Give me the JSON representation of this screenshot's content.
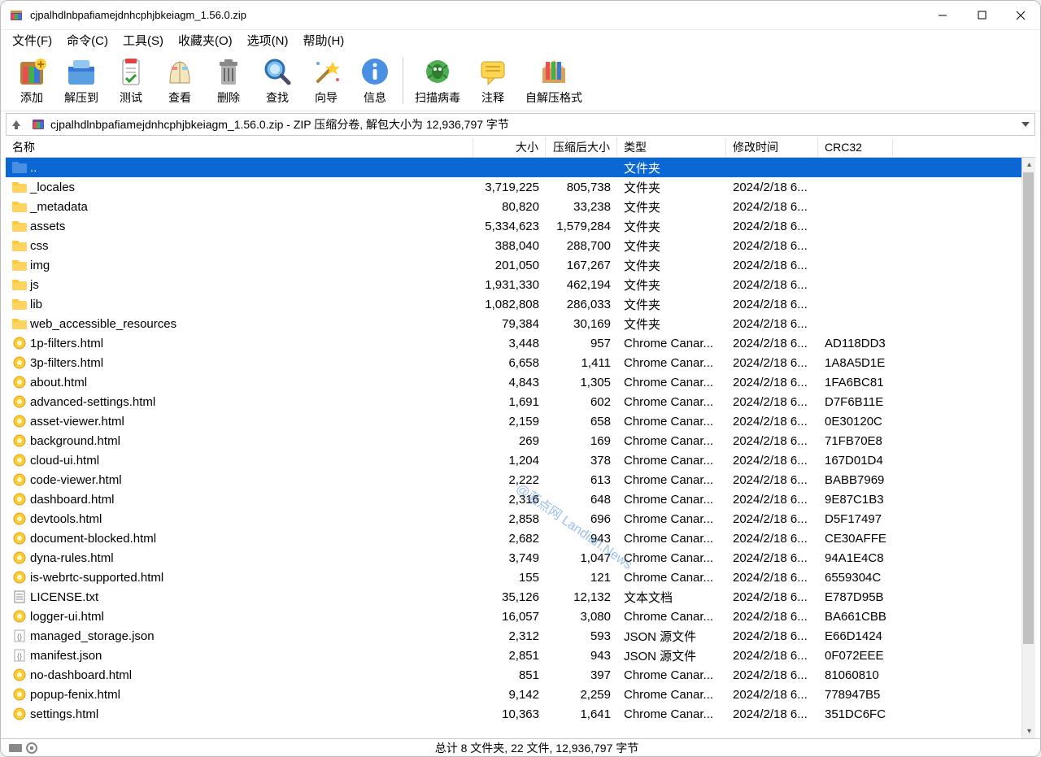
{
  "window": {
    "title": "cjpalhdlnbpafiamejdnhcphjbkeiagm_1.56.0.zip"
  },
  "menu": {
    "file": "文件(F)",
    "command": "命令(C)",
    "tools": "工具(S)",
    "favorites": "收藏夹(O)",
    "options": "选项(N)",
    "help": "帮助(H)"
  },
  "toolbar": {
    "add": "添加",
    "extract_to": "解压到",
    "test": "测试",
    "view": "查看",
    "delete": "删除",
    "find": "查找",
    "wizard": "向导",
    "info": "信息",
    "scan": "扫描病毒",
    "comment": "注释",
    "sfx": "自解压格式"
  },
  "pathbar": {
    "text": "cjpalhdlnbpafiamejdnhcphjbkeiagm_1.56.0.zip - ZIP 压缩分卷, 解包大小为 12,936,797 字节"
  },
  "columns": {
    "name": "名称",
    "size": "大小",
    "packed": "压缩后大小",
    "type": "类型",
    "modified": "修改时间",
    "crc": "CRC32"
  },
  "rows": [
    {
      "name": "..",
      "size": "",
      "packed": "",
      "type": "文件夹",
      "date": "",
      "crc": "",
      "icon": "up",
      "selected": true
    },
    {
      "name": "_locales",
      "size": "3,719,225",
      "packed": "805,738",
      "type": "文件夹",
      "date": "2024/2/18 6...",
      "crc": "",
      "icon": "folder"
    },
    {
      "name": "_metadata",
      "size": "80,820",
      "packed": "33,238",
      "type": "文件夹",
      "date": "2024/2/18 6...",
      "crc": "",
      "icon": "folder"
    },
    {
      "name": "assets",
      "size": "5,334,623",
      "packed": "1,579,284",
      "type": "文件夹",
      "date": "2024/2/18 6...",
      "crc": "",
      "icon": "folder"
    },
    {
      "name": "css",
      "size": "388,040",
      "packed": "288,700",
      "type": "文件夹",
      "date": "2024/2/18 6...",
      "crc": "",
      "icon": "folder"
    },
    {
      "name": "img",
      "size": "201,050",
      "packed": "167,267",
      "type": "文件夹",
      "date": "2024/2/18 6...",
      "crc": "",
      "icon": "folder"
    },
    {
      "name": "js",
      "size": "1,931,330",
      "packed": "462,194",
      "type": "文件夹",
      "date": "2024/2/18 6...",
      "crc": "",
      "icon": "folder"
    },
    {
      "name": "lib",
      "size": "1,082,808",
      "packed": "286,033",
      "type": "文件夹",
      "date": "2024/2/18 6...",
      "crc": "",
      "icon": "folder"
    },
    {
      "name": "web_accessible_resources",
      "size": "79,384",
      "packed": "30,169",
      "type": "文件夹",
      "date": "2024/2/18 6...",
      "crc": "",
      "icon": "folder"
    },
    {
      "name": "1p-filters.html",
      "size": "3,448",
      "packed": "957",
      "type": "Chrome Canar...",
      "date": "2024/2/18 6...",
      "crc": "AD118DD3",
      "icon": "html"
    },
    {
      "name": "3p-filters.html",
      "size": "6,658",
      "packed": "1,411",
      "type": "Chrome Canar...",
      "date": "2024/2/18 6...",
      "crc": "1A8A5D1E",
      "icon": "html"
    },
    {
      "name": "about.html",
      "size": "4,843",
      "packed": "1,305",
      "type": "Chrome Canar...",
      "date": "2024/2/18 6...",
      "crc": "1FA6BC81",
      "icon": "html"
    },
    {
      "name": "advanced-settings.html",
      "size": "1,691",
      "packed": "602",
      "type": "Chrome Canar...",
      "date": "2024/2/18 6...",
      "crc": "D7F6B11E",
      "icon": "html"
    },
    {
      "name": "asset-viewer.html",
      "size": "2,159",
      "packed": "658",
      "type": "Chrome Canar...",
      "date": "2024/2/18 6...",
      "crc": "0E30120C",
      "icon": "html"
    },
    {
      "name": "background.html",
      "size": "269",
      "packed": "169",
      "type": "Chrome Canar...",
      "date": "2024/2/18 6...",
      "crc": "71FB70E8",
      "icon": "html"
    },
    {
      "name": "cloud-ui.html",
      "size": "1,204",
      "packed": "378",
      "type": "Chrome Canar...",
      "date": "2024/2/18 6...",
      "crc": "167D01D4",
      "icon": "html"
    },
    {
      "name": "code-viewer.html",
      "size": "2,222",
      "packed": "613",
      "type": "Chrome Canar...",
      "date": "2024/2/18 6...",
      "crc": "BABB7969",
      "icon": "html"
    },
    {
      "name": "dashboard.html",
      "size": "2,316",
      "packed": "648",
      "type": "Chrome Canar...",
      "date": "2024/2/18 6...",
      "crc": "9E87C1B3",
      "icon": "html"
    },
    {
      "name": "devtools.html",
      "size": "2,858",
      "packed": "696",
      "type": "Chrome Canar...",
      "date": "2024/2/18 6...",
      "crc": "D5F17497",
      "icon": "html"
    },
    {
      "name": "document-blocked.html",
      "size": "2,682",
      "packed": "943",
      "type": "Chrome Canar...",
      "date": "2024/2/18 6...",
      "crc": "CE30AFFE",
      "icon": "html"
    },
    {
      "name": "dyna-rules.html",
      "size": "3,749",
      "packed": "1,047",
      "type": "Chrome Canar...",
      "date": "2024/2/18 6...",
      "crc": "94A1E4C8",
      "icon": "html"
    },
    {
      "name": "is-webrtc-supported.html",
      "size": "155",
      "packed": "121",
      "type": "Chrome Canar...",
      "date": "2024/2/18 6...",
      "crc": "6559304C",
      "icon": "html"
    },
    {
      "name": "LICENSE.txt",
      "size": "35,126",
      "packed": "12,132",
      "type": "文本文档",
      "date": "2024/2/18 6...",
      "crc": "E787D95B",
      "icon": "txt"
    },
    {
      "name": "logger-ui.html",
      "size": "16,057",
      "packed": "3,080",
      "type": "Chrome Canar...",
      "date": "2024/2/18 6...",
      "crc": "BA661CBB",
      "icon": "html"
    },
    {
      "name": "managed_storage.json",
      "size": "2,312",
      "packed": "593",
      "type": "JSON 源文件",
      "date": "2024/2/18 6...",
      "crc": "E66D1424",
      "icon": "json"
    },
    {
      "name": "manifest.json",
      "size": "2,851",
      "packed": "943",
      "type": "JSON 源文件",
      "date": "2024/2/18 6...",
      "crc": "0F072EEE",
      "icon": "json"
    },
    {
      "name": "no-dashboard.html",
      "size": "851",
      "packed": "397",
      "type": "Chrome Canar...",
      "date": "2024/2/18 6...",
      "crc": "81060810",
      "icon": "html"
    },
    {
      "name": "popup-fenix.html",
      "size": "9,142",
      "packed": "2,259",
      "type": "Chrome Canar...",
      "date": "2024/2/18 6...",
      "crc": "778947B5",
      "icon": "html"
    },
    {
      "name": "settings.html",
      "size": "10,363",
      "packed": "1,641",
      "type": "Chrome Canar...",
      "date": "2024/2/18 6...",
      "crc": "351DC6FC",
      "icon": "html"
    }
  ],
  "status": {
    "text": "总计 8 文件夹, 22 文件, 12,936,797 字节"
  },
  "watermark": "@蓝点网 Landian.News"
}
